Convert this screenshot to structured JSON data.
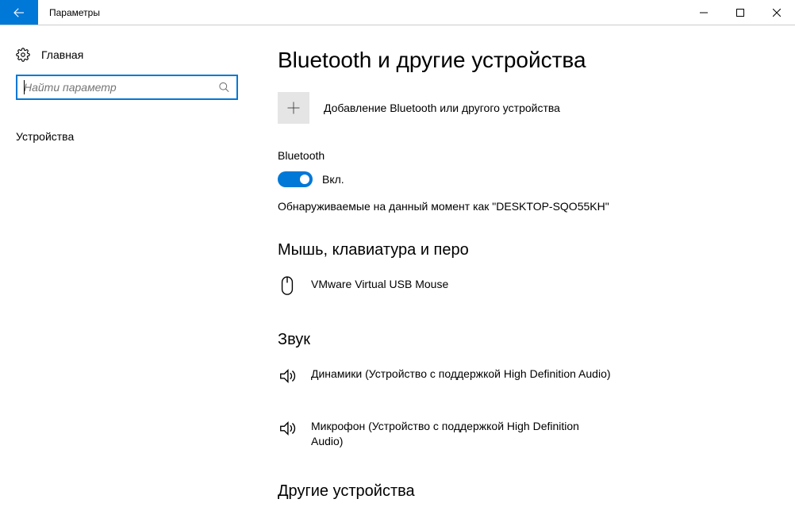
{
  "window": {
    "title": "Параметры"
  },
  "sidebar": {
    "home_label": "Главная",
    "search_placeholder": "Найти параметр",
    "category": "Устройства"
  },
  "page": {
    "title": "Bluetooth и другие устройства",
    "add_device": {
      "label": "Добавление Bluetooth или другого устройства"
    },
    "bluetooth": {
      "heading": "Bluetooth",
      "state_label": "Вкл.",
      "discoverable_text": "Обнаруживаемые на данный момент как \"DESKTOP-SQO55KH\""
    },
    "groups": {
      "mouse_kb_pen": {
        "heading": "Мышь, клавиатура и перо"
      },
      "sound": {
        "heading": "Звук"
      },
      "other": {
        "heading": "Другие устройства"
      }
    },
    "devices": {
      "mouse": {
        "name": "VMware Virtual USB Mouse"
      },
      "speakers": {
        "name": "Динамики (Устройство с поддержкой High Definition Audio)"
      },
      "mic": {
        "name": "Микрофон (Устройство с поддержкой High Definition Audio)"
      }
    }
  }
}
